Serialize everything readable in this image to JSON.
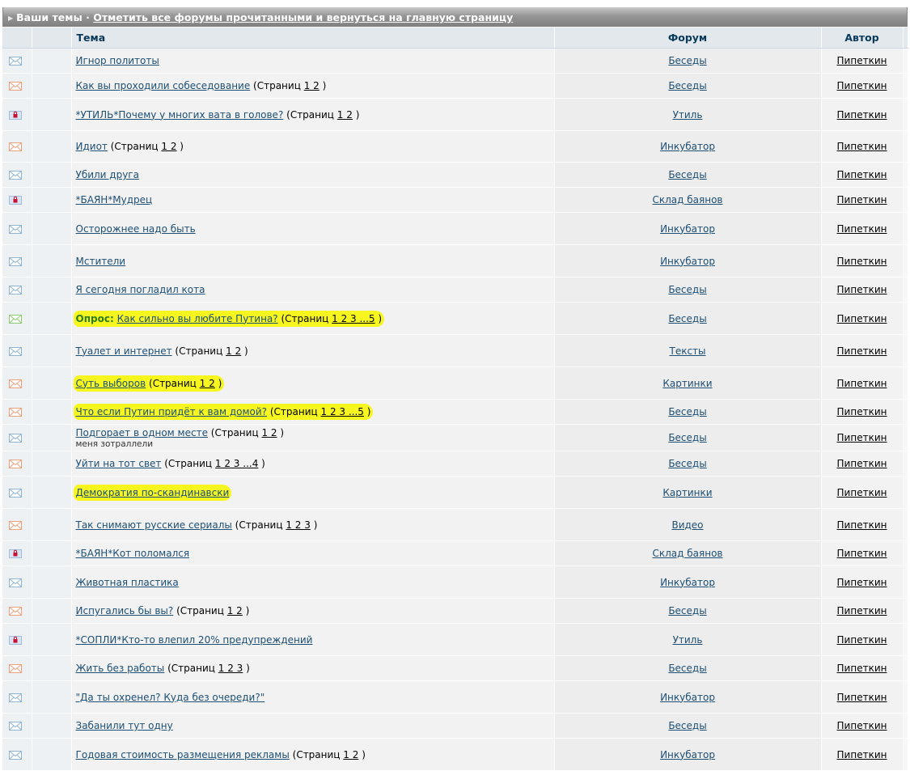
{
  "header": {
    "title": "Ваши темы",
    "separator": "·",
    "mark_all_link": "Отметить все форумы прочитанными и вернуться на главную страницу"
  },
  "columns": {
    "topic": "Тема",
    "forum": "Форум",
    "author": "Автор"
  },
  "icon_colors": {
    "read": "#8fb5d6",
    "hot": "#f0a07a",
    "locked": "#a0bde0",
    "poll": "#8ccf6e"
  },
  "pages_label": "Страниц",
  "poll_prefix": "Опрос:",
  "topics": [
    {
      "icon": "read",
      "title": "Игнор политоты",
      "pages": "",
      "forum": "Беседы",
      "author": "Пипеткин"
    },
    {
      "icon": "hot",
      "title": "Как вы проходили собеседование",
      "pages": "1 2",
      "forum": "Беседы",
      "author": "Пипеткин"
    },
    {
      "icon": "locked",
      "title": "*УТИЛЬ*Почему у многих вата в голове?",
      "pages": "1 2",
      "forum": "Утиль",
      "author": "Пипеткин"
    },
    {
      "icon": "hot",
      "title": "Идиот",
      "pages": "1 2",
      "forum": "Инкубатор",
      "author": "Пипеткин"
    },
    {
      "icon": "read",
      "title": "Убили друга",
      "pages": "",
      "forum": "Беседы",
      "author": "Пипеткин"
    },
    {
      "icon": "locked",
      "title": "*БАЯН*Мудрец",
      "pages": "",
      "forum": "Склад баянов",
      "author": "Пипеткин"
    },
    {
      "icon": "read",
      "title": "Осторожнее надо быть",
      "pages": "",
      "forum": "Инкубатор",
      "author": "Пипеткин"
    },
    {
      "icon": "read",
      "title": "Мстители",
      "pages": "",
      "forum": "Инкубатор",
      "author": "Пипеткин"
    },
    {
      "icon": "read",
      "title": "Я сегодня погладил кота",
      "pages": "",
      "forum": "Беседы",
      "author": "Пипеткин"
    },
    {
      "icon": "poll",
      "title": "Как сильно вы любите Путина?",
      "pages": "1 2 3 ...5",
      "forum": "Беседы",
      "author": "Пипеткин",
      "poll": true,
      "highlight": true
    },
    {
      "icon": "read",
      "title": "Туалет и интернет",
      "pages": "1 2",
      "forum": "Тексты",
      "author": "Пипеткин"
    },
    {
      "icon": "hot",
      "title": "Суть выборов",
      "pages": "1 2",
      "forum": "Картинки",
      "author": "Пипеткин",
      "highlight": true
    },
    {
      "icon": "hot",
      "title": "Что если Путин придёт к вам домой?",
      "pages": "1 2 3 ...5",
      "forum": "Беседы",
      "author": "Пипеткин",
      "highlight": true
    },
    {
      "icon": "read",
      "title": "Подгорает в одном месте",
      "pages": "1 2",
      "subtitle": "меня зотраллели",
      "forum": "Беседы",
      "author": "Пипеткин"
    },
    {
      "icon": "hot",
      "title": "Уйти на тот свет",
      "pages": "1 2 3 ...4",
      "forum": "Беседы",
      "author": "Пипеткин"
    },
    {
      "icon": "read",
      "title": "Демократия по-скандинавски",
      "pages": "",
      "forum": "Картинки",
      "author": "Пипеткин",
      "highlight": true
    },
    {
      "icon": "hot",
      "title": "Так снимают русские сериалы",
      "pages": "1 2 3",
      "forum": "Видео",
      "author": "Пипеткин"
    },
    {
      "icon": "locked",
      "title": "*БАЯН*Кот поломался",
      "pages": "",
      "forum": "Склад баянов",
      "author": "Пипеткин"
    },
    {
      "icon": "read",
      "title": "Животная пластика",
      "pages": "",
      "forum": "Инкубатор",
      "author": "Пипеткин"
    },
    {
      "icon": "hot",
      "title": "Испугались бы вы?",
      "pages": "1 2",
      "forum": "Беседы",
      "author": "Пипеткин"
    },
    {
      "icon": "locked",
      "title": "*СОПЛИ*Кто-то влепил 20% предупреждений",
      "pages": "",
      "forum": "Утиль",
      "author": "Пипеткин"
    },
    {
      "icon": "hot",
      "title": "Жить без работы",
      "pages": "1 2 3",
      "forum": "Беседы",
      "author": "Пипеткин"
    },
    {
      "icon": "read",
      "title": "\"Да ты охренел? Куда без очереди?\"",
      "pages": "",
      "forum": "Инкубатор",
      "author": "Пипеткин"
    },
    {
      "icon": "read",
      "title": "Забанили тут одну",
      "pages": "",
      "forum": "Беседы",
      "author": "Пипеткин"
    },
    {
      "icon": "read",
      "title": "Годовая стоимость размещения рекламы",
      "pages": "1 2",
      "forum": "Инкубатор",
      "author": "Пипеткин"
    }
  ]
}
